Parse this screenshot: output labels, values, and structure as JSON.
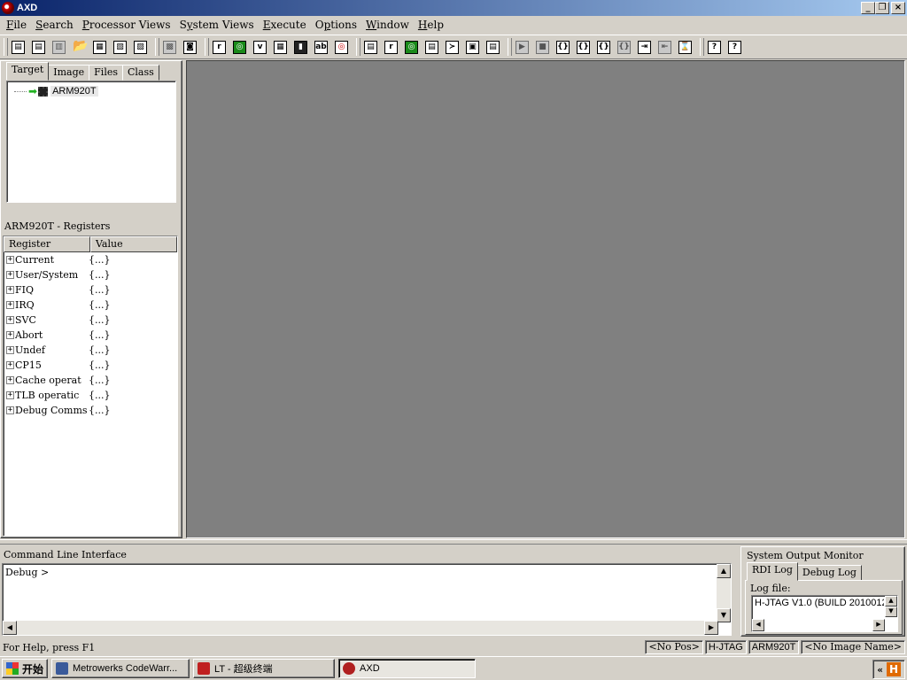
{
  "window": {
    "title": "AXD"
  },
  "menu": [
    {
      "pre": "",
      "ul": "F",
      "post": "ile"
    },
    {
      "pre": "",
      "ul": "S",
      "post": "earch"
    },
    {
      "pre": "",
      "ul": "P",
      "post": "rocessor Views"
    },
    {
      "pre": "S",
      "ul": "y",
      "post": "stem Views"
    },
    {
      "pre": "",
      "ul": "E",
      "post": "xecute"
    },
    {
      "pre": "O",
      "ul": "p",
      "post": "tions"
    },
    {
      "pre": "",
      "ul": "W",
      "post": "indow"
    },
    {
      "pre": "",
      "ul": "H",
      "post": "elp"
    }
  ],
  "toolbar": {
    "groups": [
      [
        {
          "name": "load-image",
          "g": "▤"
        },
        {
          "name": "load-symbols",
          "g": "▤"
        },
        {
          "name": "reload",
          "g": "▥",
          "grey": true
        },
        {
          "name": "open-file",
          "g": "📂",
          "noframe": true
        },
        {
          "name": "save-memory",
          "g": "▦"
        },
        {
          "name": "copy",
          "g": "▧"
        },
        {
          "name": "paste",
          "g": "▨"
        }
      ],
      [
        {
          "name": "connect",
          "g": "▩",
          "grey": true
        },
        {
          "name": "find",
          "g": "◙"
        }
      ],
      [
        {
          "name": "registers-view",
          "g": "r"
        },
        {
          "name": "watch-view",
          "g": "◎",
          "green": true
        },
        {
          "name": "variables-view",
          "g": "v"
        },
        {
          "name": "memory-view",
          "g": "▦"
        },
        {
          "name": "disassembly-view",
          "g": "▮",
          "dark": true
        },
        {
          "name": "low-level-symbols",
          "g": "ab"
        },
        {
          "name": "expression-view",
          "g": "◎",
          "red": true
        }
      ],
      [
        {
          "name": "system-registers",
          "g": "▤"
        },
        {
          "name": "system-r",
          "g": "r"
        },
        {
          "name": "system-watch",
          "g": "◎",
          "green": true
        },
        {
          "name": "system-list",
          "g": "▤"
        },
        {
          "name": "system-cli",
          "g": "≻"
        },
        {
          "name": "system-output",
          "g": "▣"
        },
        {
          "name": "system-stack",
          "g": "▤"
        }
      ],
      [
        {
          "name": "run",
          "g": "▶",
          "grey": true
        },
        {
          "name": "stop",
          "g": "■",
          "grey": true
        },
        {
          "name": "step-in",
          "g": "{}"
        },
        {
          "name": "step",
          "g": "{}"
        },
        {
          "name": "step-out",
          "g": "{}"
        },
        {
          "name": "run-to-cursor",
          "g": "{}",
          "grey": true
        },
        {
          "name": "set-pc",
          "g": "⇥"
        },
        {
          "name": "breakpoint",
          "g": "⇤",
          "grey": true
        },
        {
          "name": "wait",
          "g": "⌛"
        }
      ],
      [
        {
          "name": "help",
          "g": "?"
        },
        {
          "name": "context-help",
          "g": "?"
        }
      ]
    ]
  },
  "target_tabs": [
    "Target",
    "Image",
    "Files",
    "Class"
  ],
  "target_tree": {
    "item": "ARM920T"
  },
  "registers": {
    "title": "ARM920T - Registers",
    "columns": [
      "Register",
      "Value"
    ],
    "rows": [
      {
        "name": "Current",
        "value": "{...}"
      },
      {
        "name": "User/System",
        "value": "{...}"
      },
      {
        "name": "FIQ",
        "value": "{...}"
      },
      {
        "name": "IRQ",
        "value": "{...}"
      },
      {
        "name": "SVC",
        "value": "{...}"
      },
      {
        "name": "Abort",
        "value": "{...}"
      },
      {
        "name": "Undef",
        "value": "{...}"
      },
      {
        "name": "CP15",
        "value": "{...}"
      },
      {
        "name": "Cache operat",
        "value": "{...}"
      },
      {
        "name": "TLB operatic",
        "value": "{...}"
      },
      {
        "name": "Debug Comms",
        "value": "{...}"
      }
    ]
  },
  "cli": {
    "title": "Command Line Interface",
    "prompt": "Debug >"
  },
  "monitor": {
    "title": "System Output Monitor",
    "tabs": [
      "RDI Log",
      "Debug Log"
    ],
    "logfile_label": "Log file:",
    "logfile_text": "H-JTAG V1.0 (BUILD 2010012"
  },
  "status": {
    "help": "For Help, press F1",
    "pos": "<No Pos>",
    "target": "H-JTAG",
    "processor": "ARM920T",
    "image": "<No Image Name>"
  },
  "taskbar": {
    "start": "开始",
    "tasks": [
      {
        "label": "Metrowerks CodeWarr...",
        "active": false
      },
      {
        "label": "LT - 超级终端",
        "active": false
      },
      {
        "label": "AXD",
        "active": true
      }
    ],
    "tray_arrow": "«",
    "tray_icon": "H"
  }
}
